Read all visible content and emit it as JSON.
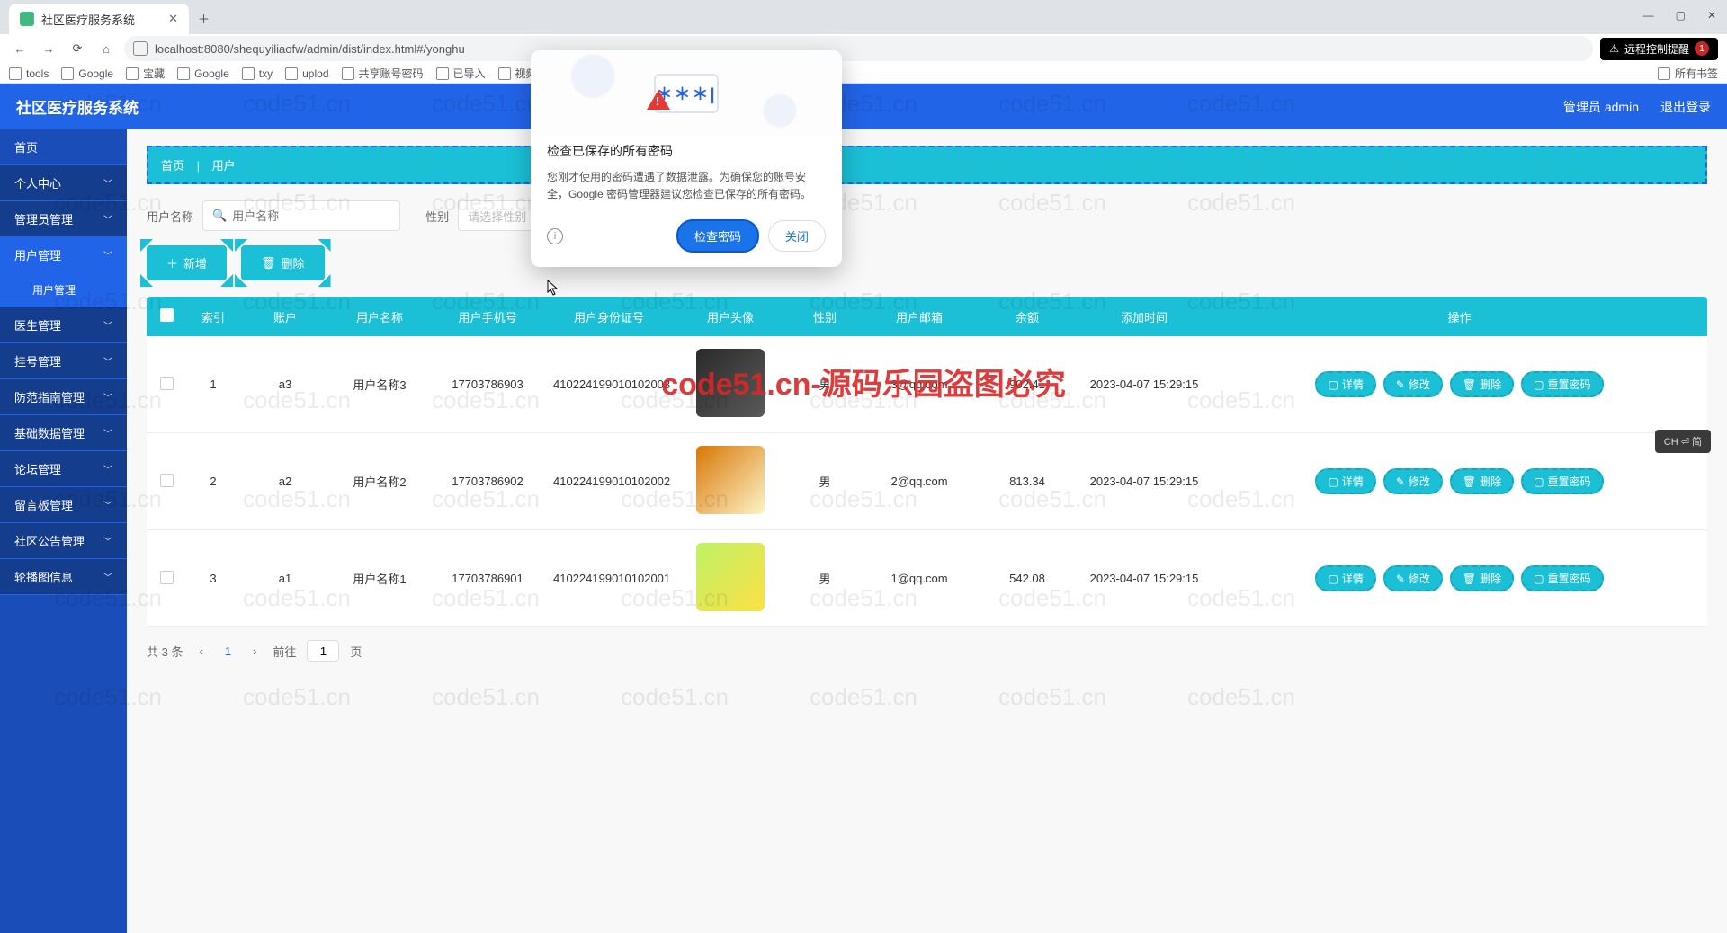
{
  "browser": {
    "tab_title": "社区医疗服务系统",
    "url": "localhost:8080/shequyiliaofw/admin/dist/index.html#/yonghu",
    "bookmarks": [
      "tools",
      "Google",
      "宝藏",
      "Google",
      "txy",
      "uplod",
      "共享账号密码",
      "已导入",
      "视频下载"
    ],
    "all_bookmarks": "所有书签",
    "remote_warning": "远程控制提醒",
    "remote_count": "1"
  },
  "header": {
    "title": "社区医疗服务系统",
    "admin_label": "管理员 admin",
    "logout": "退出登录"
  },
  "sidebar": {
    "items": [
      {
        "label": "首页",
        "expand": false
      },
      {
        "label": "个人中心",
        "expand": true
      },
      {
        "label": "管理员管理",
        "expand": true
      },
      {
        "label": "用户管理",
        "expand": true,
        "active": true
      },
      {
        "label": "用户管理",
        "sub": true
      },
      {
        "label": "医生管理",
        "expand": true
      },
      {
        "label": "挂号管理",
        "expand": true
      },
      {
        "label": "防范指南管理",
        "expand": true
      },
      {
        "label": "基础数据管理",
        "expand": true
      },
      {
        "label": "论坛管理",
        "expand": true
      },
      {
        "label": "留言板管理",
        "expand": true
      },
      {
        "label": "社区公告管理",
        "expand": true
      },
      {
        "label": "轮播图信息",
        "expand": true
      }
    ]
  },
  "breadcrumb": {
    "home": "首页",
    "current": "用户"
  },
  "filters": {
    "name_label": "用户名称",
    "name_placeholder": "用户名称",
    "gender_label": "性别",
    "gender_placeholder": "请选择性别"
  },
  "actions": {
    "add": "新增",
    "delete": "删除"
  },
  "table": {
    "headers": [
      "索引",
      "账户",
      "用户名称",
      "用户手机号",
      "用户身份证号",
      "用户头像",
      "性别",
      "用户邮箱",
      "余额",
      "添加时间",
      "操作"
    ],
    "rows": [
      {
        "idx": "1",
        "account": "a3",
        "name": "用户名称3",
        "phone": "17703786903",
        "idcard": "410224199010102003",
        "gender": "男",
        "email": "3@qq.com",
        "balance": "902.41",
        "time": "2023-04-07 15:29:15"
      },
      {
        "idx": "2",
        "account": "a2",
        "name": "用户名称2",
        "phone": "17703786902",
        "idcard": "410224199010102002",
        "gender": "男",
        "email": "2@qq.com",
        "balance": "813.34",
        "time": "2023-04-07 15:29:15"
      },
      {
        "idx": "3",
        "account": "a1",
        "name": "用户名称1",
        "phone": "17703786901",
        "idcard": "410224199010102001",
        "gender": "男",
        "email": "1@qq.com",
        "balance": "542.08",
        "time": "2023-04-07 15:29:15"
      }
    ],
    "ops": {
      "detail": "详情",
      "edit": "修改",
      "delete": "删除",
      "reset": "重置密码"
    }
  },
  "pagination": {
    "total": "共 3 条",
    "current": "1",
    "goto_prefix": "前往",
    "goto_suffix": "页",
    "goto_val": "1"
  },
  "dialog": {
    "title": "检查已保存的所有密码",
    "body": "您刚才使用的密码遭遇了数据泄露。为确保您的账号安全，Google 密码管理器建议您检查已保存的所有密码。",
    "primary": "检查密码",
    "secondary": "关闭",
    "hero_text": "＊＊＊|"
  },
  "watermark": {
    "main": "code51.cn-源码乐园盗图必究",
    "bg": "code51.cn"
  },
  "ime": "CH ⏎ 简"
}
